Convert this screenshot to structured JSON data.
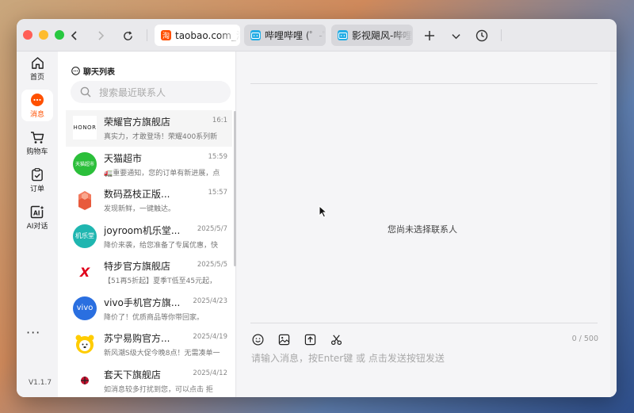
{
  "browser": {
    "tabs": [
      {
        "label": "taobao.com_淘",
        "icon": "taobao-icon",
        "color": "#ff5000"
      },
      {
        "label": "哔哩哔哩 (゜-゜",
        "icon": "bilibili-icon",
        "color": "#23ade5"
      },
      {
        "label": "影视飓风-哔哩哔",
        "icon": "bilibili-icon",
        "color": "#23ade5"
      }
    ]
  },
  "nav": {
    "items": [
      {
        "label": "首页",
        "icon": "home-icon"
      },
      {
        "label": "消息",
        "icon": "message-icon",
        "active": true
      },
      {
        "label": "购物车",
        "icon": "cart-icon"
      },
      {
        "label": "订单",
        "icon": "order-icon"
      },
      {
        "label": "AI对话",
        "icon": "ai-icon"
      }
    ],
    "more": "···",
    "version": "V1.1.7"
  },
  "chat_list": {
    "title": "聊天列表",
    "search_placeholder": "搜索最近联系人",
    "items": [
      {
        "name": "荣耀官方旗舰店",
        "time": "16:1",
        "preview": "真实力，才敢登场！荣耀400系列新",
        "avatar": "HONOR",
        "avatar_color": "#ffffff"
      },
      {
        "name": "天猫超市",
        "time": "15:59",
        "preview": "🚛重要通知，您的订单有新进展，点",
        "avatar": "天猫超市",
        "avatar_color": "#2bbf3a"
      },
      {
        "name": "数码荔枝正版...",
        "time": "15:57",
        "preview": "发现新鲜，一键触达。",
        "avatar": "",
        "avatar_color": "#f06a4a"
      },
      {
        "name": "joyroom机乐堂...",
        "time": "2025/5/7",
        "preview": "降价来袭，给您准备了专属优惠，快",
        "avatar": "机乐堂",
        "avatar_color": "#1fb6b0"
      },
      {
        "name": "特步官方旗舰店",
        "time": "2025/5/5",
        "preview": "【51再5折起】夏季T低至45元起，",
        "avatar": "X",
        "avatar_color": "#ffffff"
      },
      {
        "name": "vivo手机官方旗...",
        "time": "2025/4/23",
        "preview": "降价了！优质商品等你带回家。",
        "avatar": "vivo",
        "avatar_color": "#2a6fe0"
      },
      {
        "name": "苏宁易购官方...",
        "time": "2025/4/19",
        "preview": "新风潮S级大促今晚8点！无需凑单一",
        "avatar": "",
        "avatar_color": "#ffcc00"
      },
      {
        "name": "套天下旗舰店",
        "time": "2025/4/12",
        "preview": "如消息较多打扰到您，可以点击 拒",
        "avatar": "",
        "avatar_color": "#ffffff"
      }
    ]
  },
  "main": {
    "empty_text": "您尚未选择联系人",
    "input_placeholder": "请输入消息，按Enter键 或 点击发送按钮发送",
    "counter": "0 / 500",
    "tools": [
      "emoji-icon",
      "image-icon",
      "upload-icon",
      "scissors-icon"
    ]
  }
}
